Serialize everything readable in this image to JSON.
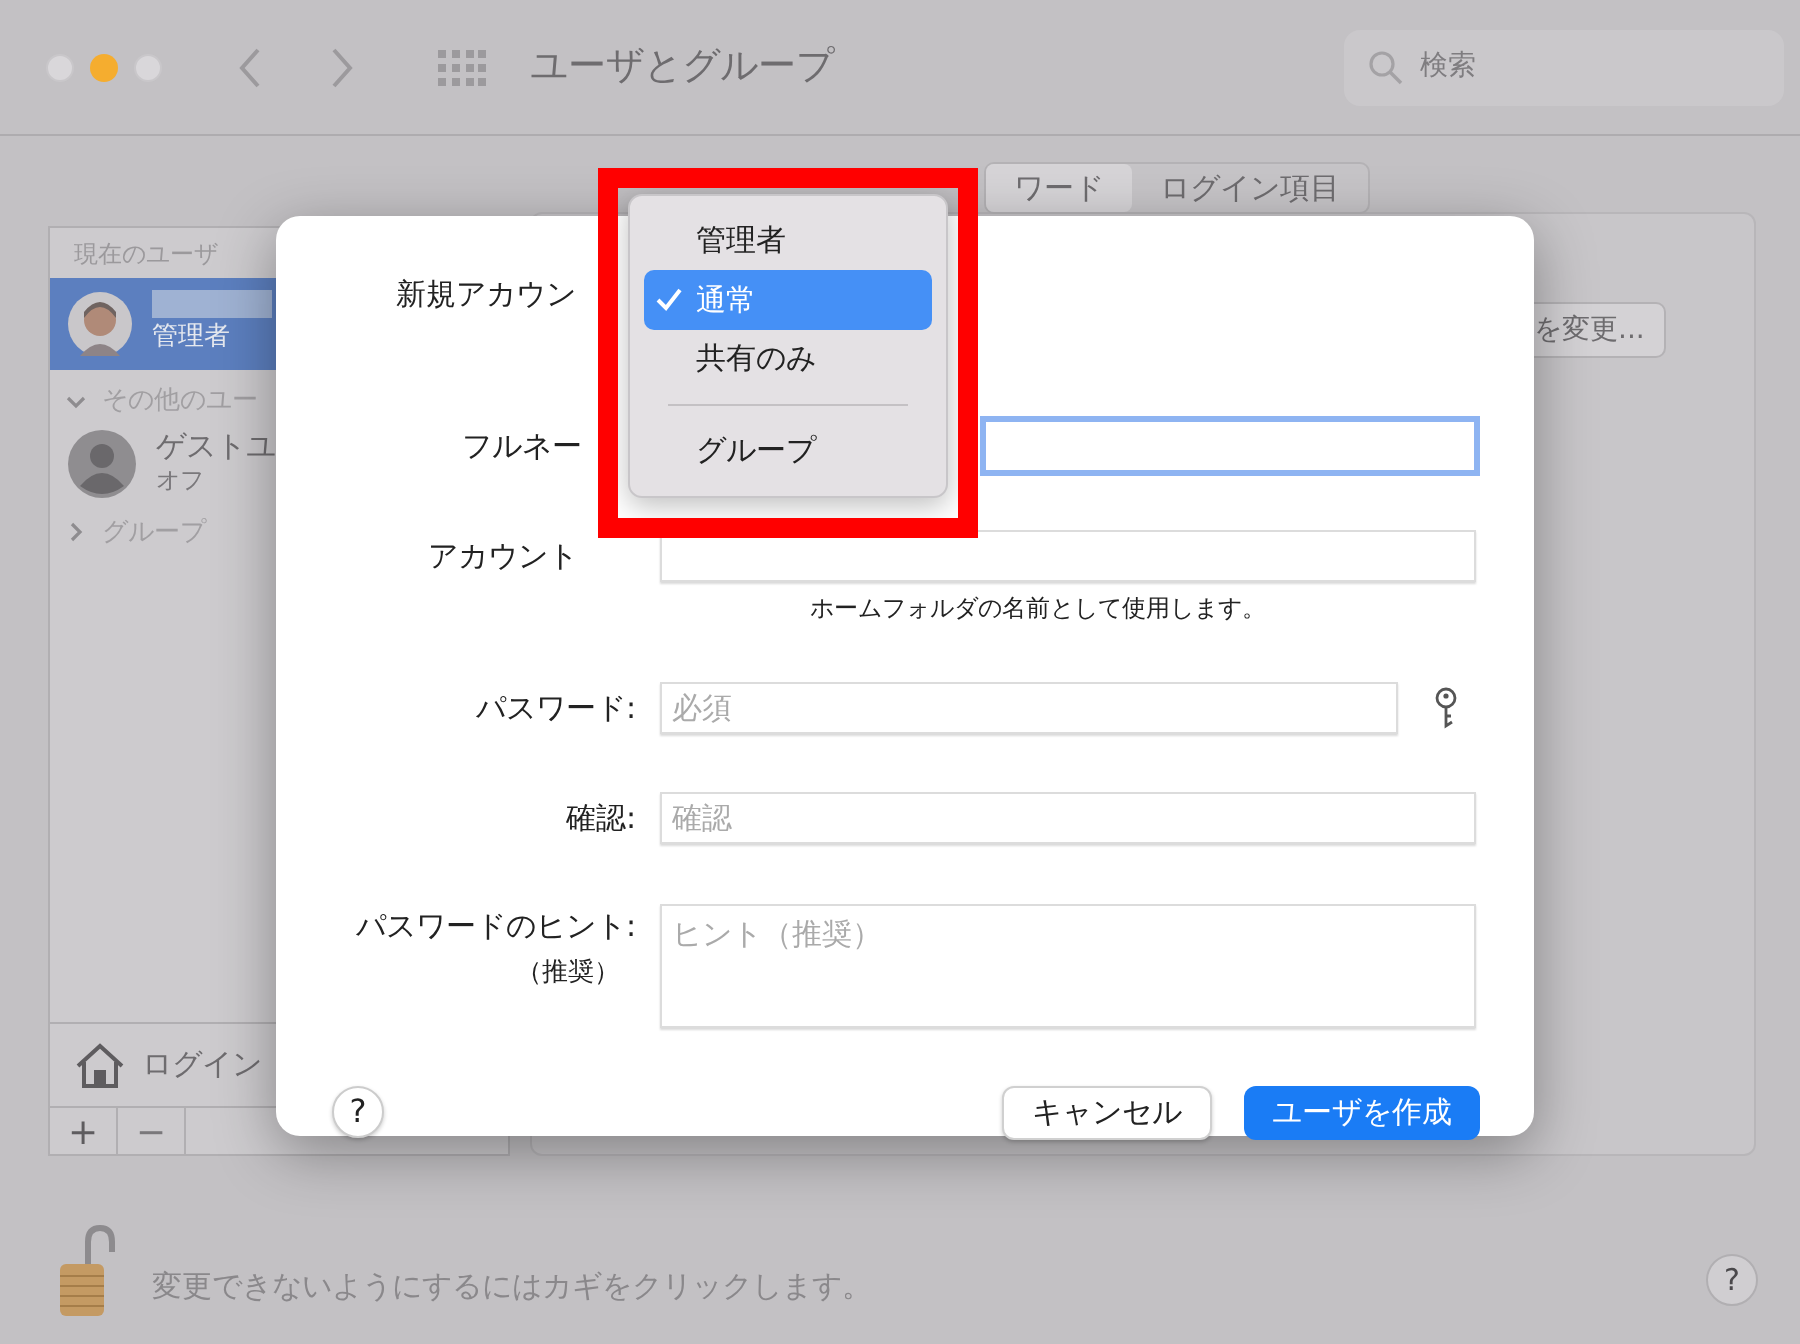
{
  "window": {
    "title": "ユーザとグループ",
    "search": {
      "placeholder": "検索"
    }
  },
  "tabs": [
    {
      "label": "ワード",
      "selected": true
    },
    {
      "label": "ログイン項目",
      "selected": false
    }
  ],
  "sidebar": {
    "current_users_label": "現在のユーザ",
    "current_user": {
      "role": "管理者",
      "selected": true
    },
    "other_users": {
      "label": "その他のユー",
      "expanded": true
    },
    "guest": {
      "name": "ゲストユ",
      "status": "オフ"
    },
    "groups": {
      "label": "グループ",
      "expanded": false
    },
    "login_options": "ログイン",
    "buttons": [
      "+",
      "−"
    ]
  },
  "change_button": "を変更...",
  "lock_message": "変更できないようにするにはカギをクリックします。",
  "help_button": "?",
  "dialog": {
    "new_account_label": "新規アカウン",
    "full_name": {
      "label": "フルネー",
      "focused": true
    },
    "account_name": {
      "label": "アカウント",
      "note": "ホームフォルダの名前として使用します。"
    },
    "password": {
      "label": "パスワード:",
      "placeholder": "必須"
    },
    "verify": {
      "label": "確認:",
      "placeholder": "確認"
    },
    "hint": {
      "label": "パスワードのヒント:",
      "sublabel": "（推奨）",
      "placeholder": "ヒント（推奨）"
    },
    "help_button": "?",
    "buttons": [
      {
        "label": "キャンセル",
        "kind": "secondary"
      },
      {
        "label": "ユーザを作成",
        "kind": "primary"
      }
    ]
  },
  "account_type_menu": {
    "items": [
      {
        "kind": "item",
        "label": "管理者",
        "selected": false
      },
      {
        "kind": "item",
        "label": "通常",
        "selected": true
      },
      {
        "kind": "item",
        "label": "共有のみ",
        "selected": false
      },
      {
        "kind": "separator"
      },
      {
        "kind": "item",
        "label": "グループ",
        "selected": false
      }
    ]
  }
}
